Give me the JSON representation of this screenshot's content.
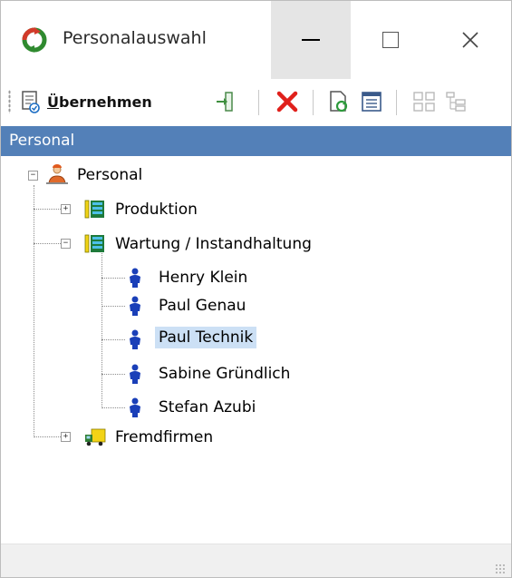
{
  "window": {
    "title": "Personalauswahl",
    "controls": {
      "minimize": "—",
      "maximize": "☐",
      "close": "✕"
    }
  },
  "toolbar": {
    "apply_label_underlined": "Ü",
    "apply_label_rest": "bernehmen"
  },
  "panel": {
    "header": "Personal"
  },
  "tree": {
    "root": {
      "label": "Personal",
      "icon": "person-group-icon"
    },
    "groups": [
      {
        "label": "Produktion",
        "icon": "department-icon",
        "expanded": false
      },
      {
        "label": "Wartung / Instandhaltung",
        "icon": "department-icon",
        "expanded": true,
        "children": [
          {
            "label": "Henry Klein",
            "selected": false
          },
          {
            "label": "Paul Genau",
            "selected": false
          },
          {
            "label": "Paul Technik",
            "selected": true
          },
          {
            "label": "Sabine Gründlich",
            "selected": false
          },
          {
            "label": "Stefan Azubi",
            "selected": false
          }
        ]
      },
      {
        "label": "Fremdfirmen",
        "icon": "truck-icon",
        "expanded": false
      }
    ]
  },
  "colors": {
    "header_bg": "#5380b8",
    "selection_bg": "#cce0f5",
    "person_icon": "#1a3fb8",
    "delete_red": "#e0201b"
  }
}
